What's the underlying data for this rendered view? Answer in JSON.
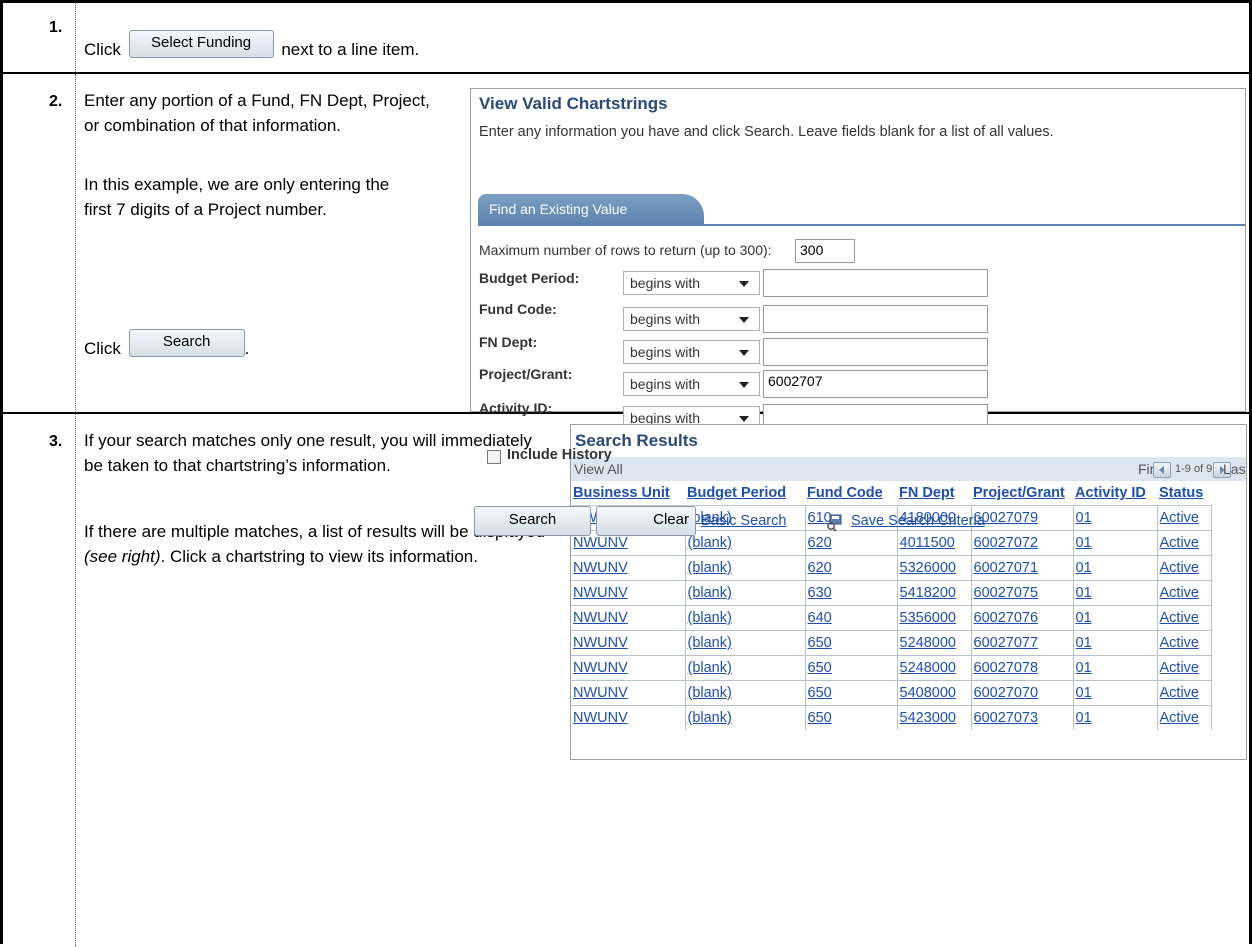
{
  "steps": [
    {
      "number": "1.",
      "text_before": "Click",
      "button_label": "Select Funding",
      "text_after": "next to a line item."
    },
    {
      "number": "2.",
      "para1": "Enter any portion of a Fund, FN Dept, Project, or combination of that information.",
      "para2": "In this example, we are only entering the first 7 digits of a Project number.",
      "click_text": "Click",
      "button_label": "Search",
      "period": "."
    },
    {
      "number": "3.",
      "para1": "If your search matches only one result, you will immediately be taken to that chartstring’s information.",
      "para2_a": "If there are multiple matches, a list of results will be displayed ",
      "para2_em": "(see right)",
      "para2_b": ".  Click a chartstring to view its information."
    }
  ],
  "search_panel": {
    "title": "View Valid Chartstrings",
    "instructions": "Enter any information you have and click Search. Leave fields blank for a list of all values.",
    "tab": "Find an Existing Value",
    "max_rows_label": "Maximum number of rows to return (up to 300):",
    "max_rows_value": "300",
    "fields": [
      {
        "label": "Budget Period:",
        "operator": "begins with",
        "value": ""
      },
      {
        "label": "Fund Code:",
        "operator": "begins with",
        "value": ""
      },
      {
        "label": "FN Dept:",
        "operator": "begins with",
        "value": ""
      },
      {
        "label": "Project/Grant:",
        "operator": "begins with",
        "value": "6002707"
      },
      {
        "label": "Activity ID:",
        "operator": "begins with",
        "value": ""
      }
    ],
    "include_history": "Include History",
    "search_button": "Search",
    "clear_button": "Clear",
    "basic_search": "Basic Search",
    "save_criteria": "Save Search Criteria"
  },
  "results_panel": {
    "title": "Search Results",
    "view_all": "View All",
    "first": "First",
    "count": "1-9 of 9",
    "last": "Last",
    "columns": [
      "Business Unit",
      "Budget Period",
      "Fund Code",
      "FN Dept",
      "Project/Grant",
      "Activity ID",
      "Status"
    ],
    "rows": [
      [
        "NWUNV",
        "(blank)",
        "610",
        "4180000",
        "60027079",
        "01",
        "Active"
      ],
      [
        "NWUNV",
        "(blank)",
        "620",
        "4011500",
        "60027072",
        "01",
        "Active"
      ],
      [
        "NWUNV",
        "(blank)",
        "620",
        "5326000",
        "60027071",
        "01",
        "Active"
      ],
      [
        "NWUNV",
        "(blank)",
        "630",
        "5418200",
        "60027075",
        "01",
        "Active"
      ],
      [
        "NWUNV",
        "(blank)",
        "640",
        "5356000",
        "60027076",
        "01",
        "Active"
      ],
      [
        "NWUNV",
        "(blank)",
        "650",
        "5248000",
        "60027077",
        "01",
        "Active"
      ],
      [
        "NWUNV",
        "(blank)",
        "650",
        "5248000",
        "60027078",
        "01",
        "Active"
      ],
      [
        "NWUNV",
        "(blank)",
        "650",
        "5408000",
        "60027070",
        "01",
        "Active"
      ],
      [
        "NWUNV",
        "(blank)",
        "650",
        "5423000",
        "60027073",
        "01",
        "Active"
      ]
    ]
  }
}
